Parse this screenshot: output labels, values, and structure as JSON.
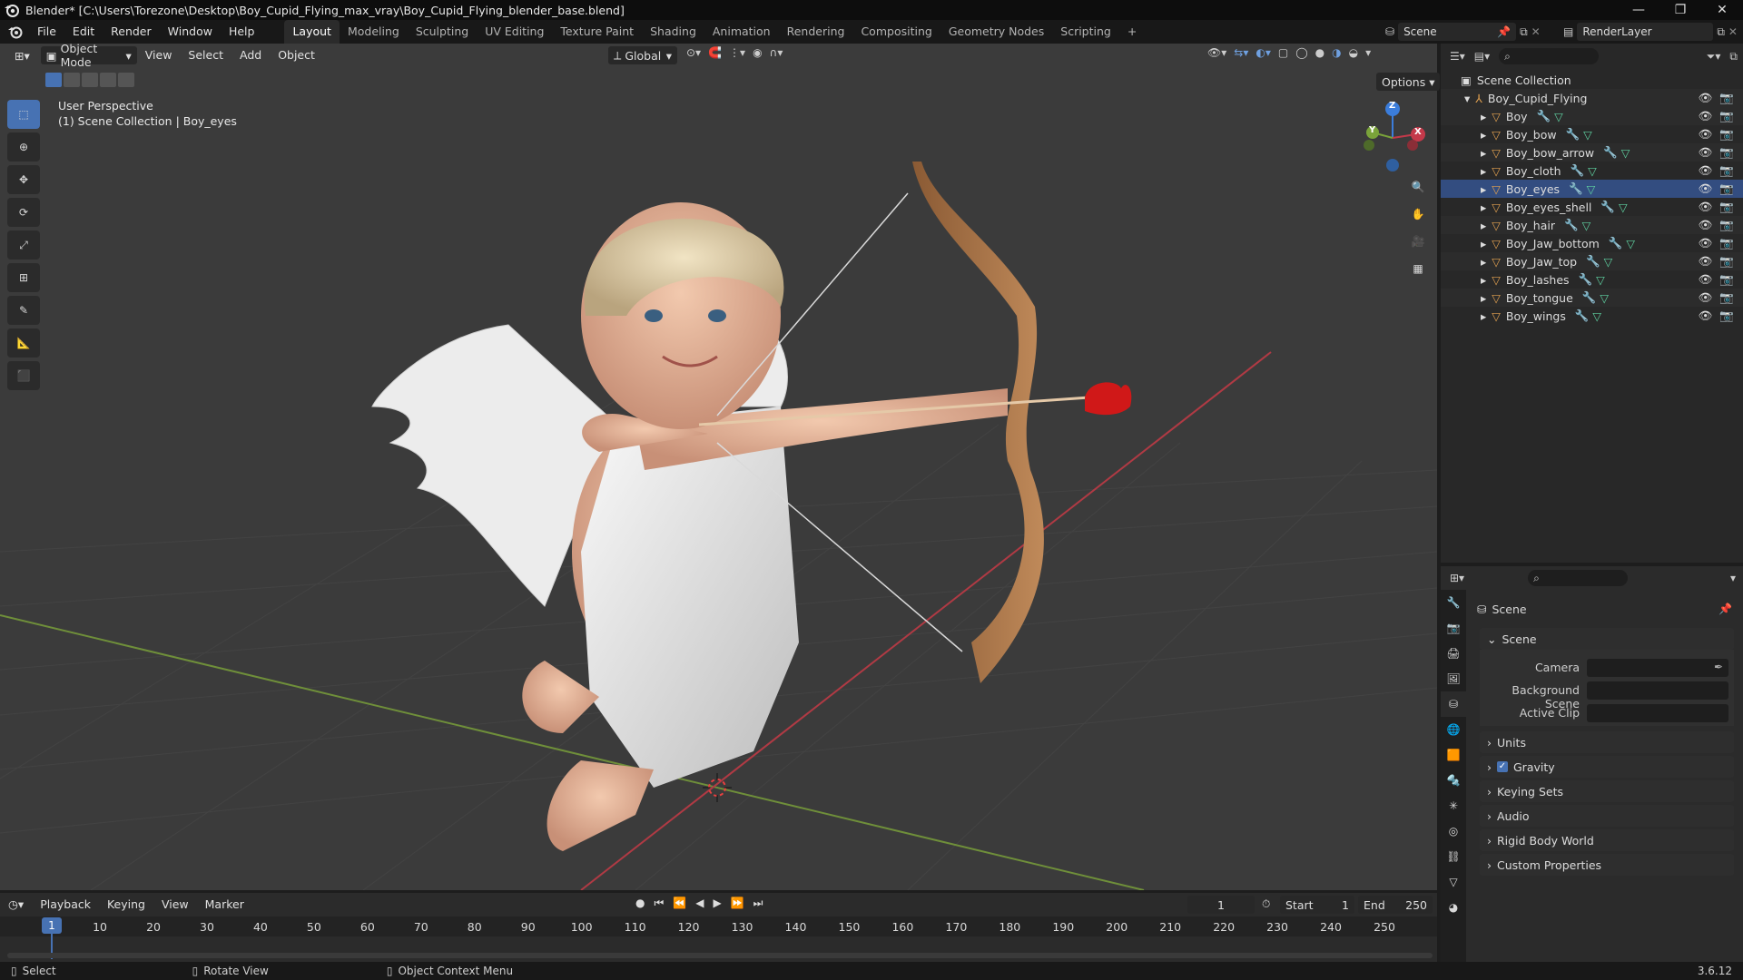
{
  "titlebar": {
    "title": "Blender* [C:\\Users\\Torezone\\Desktop\\Boy_Cupid_Flying_max_vray\\Boy_Cupid_Flying_blender_base.blend]",
    "minimize": "—",
    "maximize": "❐",
    "close": "✕"
  },
  "menubar": {
    "menus": [
      "File",
      "Edit",
      "Render",
      "Window",
      "Help"
    ],
    "workspaces": [
      "Layout",
      "Modeling",
      "Sculpting",
      "UV Editing",
      "Texture Paint",
      "Shading",
      "Animation",
      "Rendering",
      "Compositing",
      "Geometry Nodes",
      "Scripting"
    ],
    "add_workspace": "+",
    "scene": "Scene",
    "view_layer": "RenderLayer"
  },
  "viewport": {
    "mode": "Object Mode",
    "menus": [
      "View",
      "Select",
      "Add",
      "Object"
    ],
    "orientation": "Global",
    "options": "Options",
    "perspective": "User Perspective",
    "collection_info": "(1) Scene Collection | Boy_eyes",
    "axis_z": "Z",
    "axis_y": "Y",
    "axis_x": "X"
  },
  "outliner": {
    "root": "Scene Collection",
    "collection": "Boy_Cupid_Flying",
    "objects": [
      "Boy",
      "Boy_bow",
      "Boy_bow_arrow",
      "Boy_cloth",
      "Boy_eyes",
      "Boy_eyes_shell",
      "Boy_hair",
      "Boy_Jaw_bottom",
      "Boy_Jaw_top",
      "Boy_lashes",
      "Boy_tongue",
      "Boy_wings"
    ],
    "selected_index": 4
  },
  "properties": {
    "context": "Scene",
    "panel": "Scene",
    "camera_label": "Camera",
    "background_scene_label": "Background Scene",
    "active_clip_label": "Active Clip",
    "sections": [
      "Units",
      "Gravity",
      "Keying Sets",
      "Audio",
      "Rigid Body World",
      "Custom Properties"
    ],
    "gravity_checked": true
  },
  "timeline": {
    "menus": [
      "Playback",
      "Keying",
      "View",
      "Marker"
    ],
    "current_frame": "1",
    "start_label": "Start",
    "start": "1",
    "end_label": "End",
    "end": "250",
    "ticks": [
      "10",
      "20",
      "30",
      "40",
      "50",
      "60",
      "70",
      "80",
      "90",
      "100",
      "110",
      "120",
      "130",
      "140",
      "150",
      "160",
      "170",
      "180",
      "190",
      "200",
      "210",
      "220",
      "230",
      "240",
      "250"
    ],
    "playhead": "1"
  },
  "statusbar": {
    "select": "Select",
    "rotate": "Rotate View",
    "context_menu": "Object Context Menu",
    "version": "3.6.12"
  },
  "colors": {
    "accent": "#4772b3",
    "viewport_bg": "#3b3b3b",
    "x_axis": "#c4394a",
    "y_axis": "#7aa33a",
    "z_axis": "#3b7ddb"
  }
}
